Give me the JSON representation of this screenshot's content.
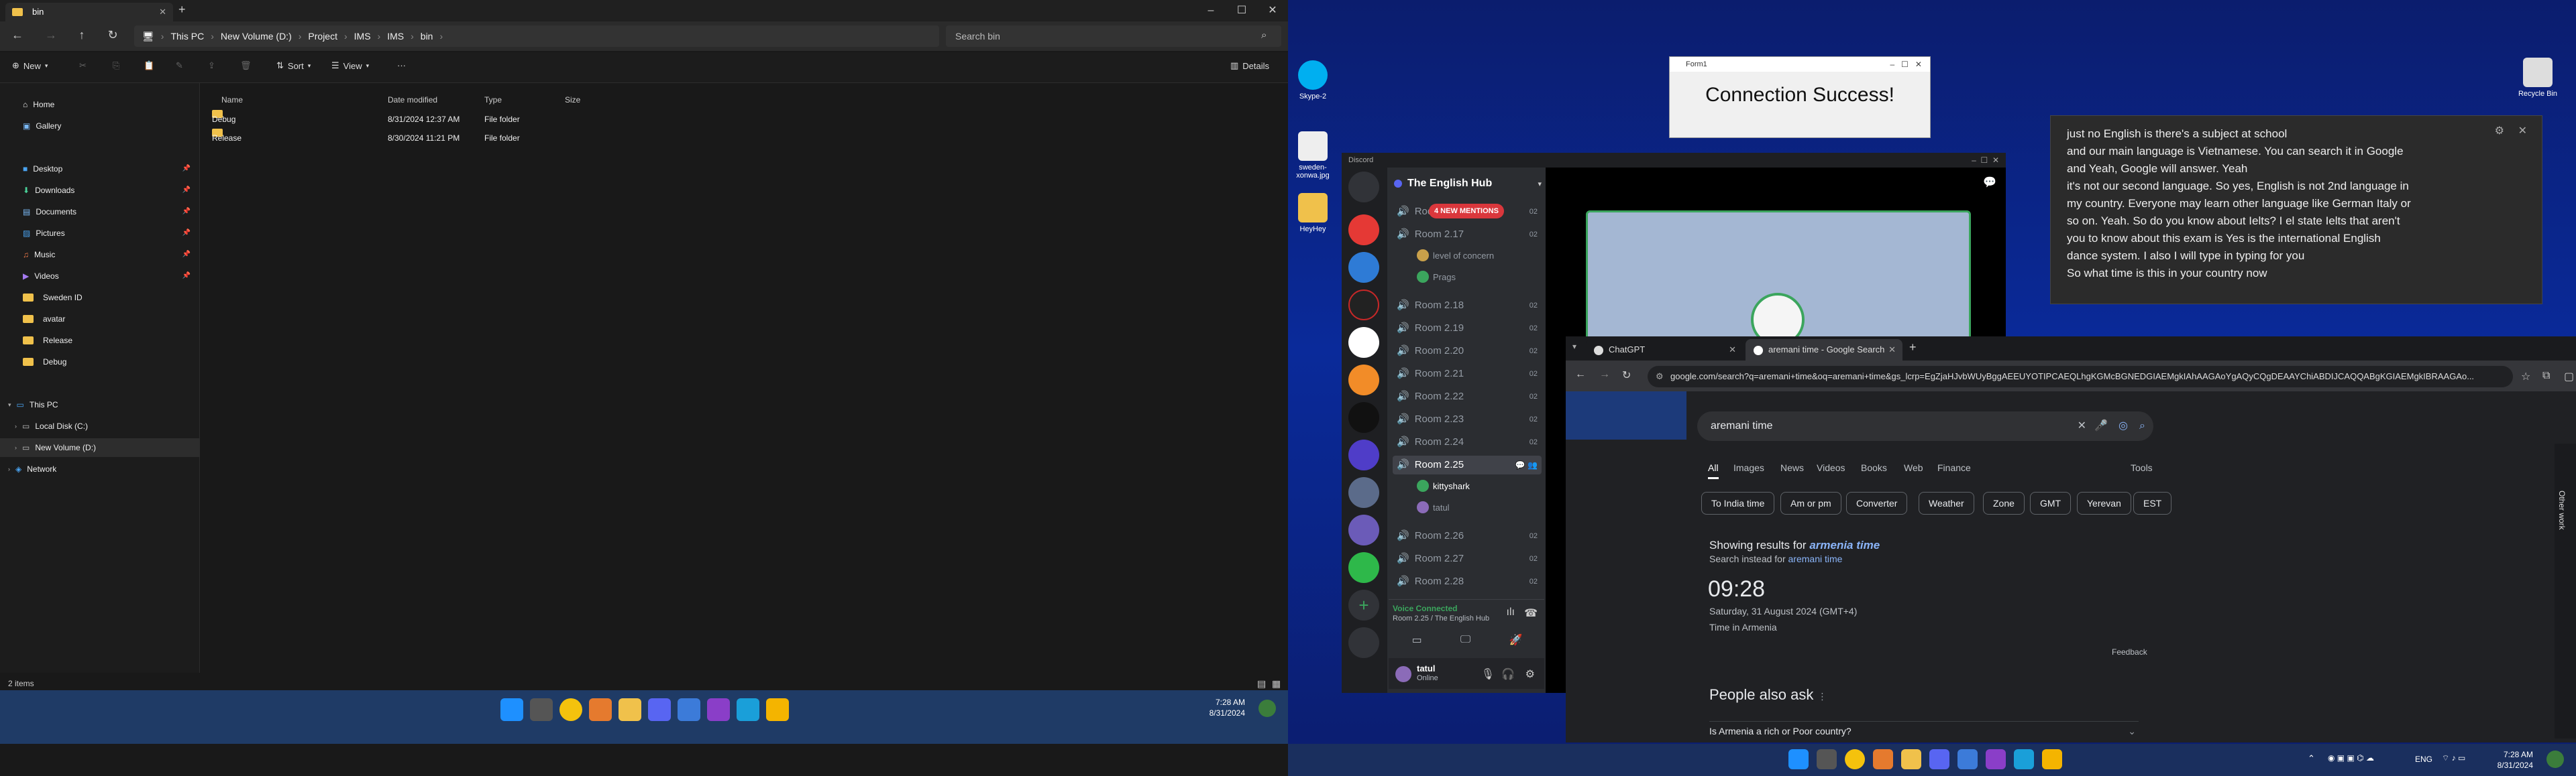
{
  "explorer": {
    "tab_title": "bin",
    "breadcrumb": [
      "This PC",
      "New Volume (D:)",
      "Project",
      "IMS",
      "IMS",
      "bin"
    ],
    "search_placeholder": "Search bin",
    "commands": {
      "new": "New",
      "sort": "Sort",
      "view": "View",
      "details": "Details"
    },
    "nav": [
      {
        "label": "Home",
        "icon": "home-icon"
      },
      {
        "label": "Gallery",
        "icon": "gallery-icon"
      },
      {
        "label": "Desktop",
        "icon": "desktop-icon",
        "pinned": true
      },
      {
        "label": "Downloads",
        "icon": "downloads-icon",
        "pinned": true
      },
      {
        "label": "Documents",
        "icon": "documents-icon",
        "pinned": true
      },
      {
        "label": "Pictures",
        "icon": "pictures-icon",
        "pinned": true
      },
      {
        "label": "Music",
        "icon": "music-icon",
        "pinned": true
      },
      {
        "label": "Videos",
        "icon": "videos-icon",
        "pinned": true
      },
      {
        "label": "Sweden ID",
        "icon": "folder-icon"
      },
      {
        "label": "avatar",
        "icon": "folder-icon"
      },
      {
        "label": "Release",
        "icon": "folder-icon"
      },
      {
        "label": "Debug",
        "icon": "folder-icon"
      },
      {
        "label": "This PC",
        "icon": "pc-icon"
      },
      {
        "label": "Local Disk (C:)",
        "icon": "drive-icon"
      },
      {
        "label": "New Volume (D:)",
        "icon": "drive-icon"
      },
      {
        "label": "Network",
        "icon": "network-icon"
      }
    ],
    "columns": [
      "Name",
      "Date modified",
      "Type",
      "Size"
    ],
    "files": [
      {
        "name": "Debug",
        "date": "8/31/2024 12:37 AM",
        "type": "File folder"
      },
      {
        "name": "Release",
        "date": "8/30/2024 11:21 PM",
        "type": "File folder"
      }
    ],
    "status": "2 items"
  },
  "taskbar": {
    "left_time": "7:28 AM",
    "left_date": "8/31/2024",
    "right_time": "7:28 AM",
    "right_date": "8/31/2024",
    "lang": "ENG"
  },
  "desktop": {
    "icons": [
      "Skype-2",
      "sweden-xonwa.jpg",
      "HeyHey",
      "Recycle Bin"
    ]
  },
  "form1": {
    "title": "Form1",
    "message": "Connection Success!"
  },
  "notepad": {
    "lines": [
      "just no English is there's a subject at school",
      "and our main language is Vietnamese. You can search it in Google",
      "and Yeah, Google will answer. Yeah",
      "it's not our second language. So yes, English is not 2nd language in",
      "my country. Everyone may learn other language like German Italy or",
      "so on. Yeah. So do you know about Ielts? I el state Ielts that aren't",
      "you to know about this exam is Yes is the international English",
      "dance system. I also I will type in typing for you",
      "So what time is this in your country now"
    ]
  },
  "discord": {
    "app_title": "Discord",
    "server_name": "The English Hub",
    "mentions_badge": "4 NEW MENTIONS",
    "channels": [
      {
        "name": "Room",
        "count": "02"
      },
      {
        "name": "Room 2.17",
        "count": "02"
      },
      {
        "name": "Room 2.18",
        "count": "02"
      },
      {
        "name": "Room 2.19",
        "count": "02"
      },
      {
        "name": "Room 2.20",
        "count": "02"
      },
      {
        "name": "Room 2.21",
        "count": "02"
      },
      {
        "name": "Room 2.22",
        "count": "02"
      },
      {
        "name": "Room 2.23",
        "count": "02"
      },
      {
        "name": "Room 2.24",
        "count": "02"
      },
      {
        "name": "Room 2.25",
        "count": ""
      },
      {
        "name": "Room 2.26",
        "count": "02"
      },
      {
        "name": "Room 2.27",
        "count": "02"
      },
      {
        "name": "Room 2.28",
        "count": "02"
      }
    ],
    "room217_users": [
      "level of concern",
      "Prags"
    ],
    "room225_users": [
      "kittyshark",
      "tatul"
    ],
    "voice_status": "Voice Connected",
    "voice_room": "Room 2.25 / The English Hub",
    "user_name": "tatul",
    "user_status": "Online"
  },
  "chrome": {
    "tabs": [
      "ChatGPT",
      "aremani time - Google Search"
    ],
    "url": "google.com/search?q=aremani+time&oq=aremani+time&gs_lcrp=EgZjaHJvbWUyBggAEEUYOTIPCAEQLhgKGMcBGNEDGIAEMgkIAhAAGAoYgAQyCQgDEAAYChiABDIJCAQQABgKGIAEMgkIBRAAGAo...",
    "search_query": "aremani time",
    "search_tabs": [
      "All",
      "Images",
      "News",
      "Videos",
      "Books",
      "Web",
      "Finance"
    ],
    "tools": "Tools",
    "chips": [
      "To India time",
      "Am or pm",
      "Converter",
      "Weather",
      "Zone",
      "GMT",
      "Yerevan",
      "EST"
    ],
    "showing_prefix": "Showing results for",
    "showing_term": "armenia time",
    "search_instead_prefix": "Search instead for",
    "search_instead_term": "aremani time",
    "time": "09:28",
    "date": "Saturday, 31 August 2024 (GMT+4)",
    "location": "Time in Armenia",
    "feedback": "Feedback",
    "people_also_ask": "People also ask",
    "question": "Is Armenia a rich or Poor country?",
    "side_label": "Other work"
  }
}
